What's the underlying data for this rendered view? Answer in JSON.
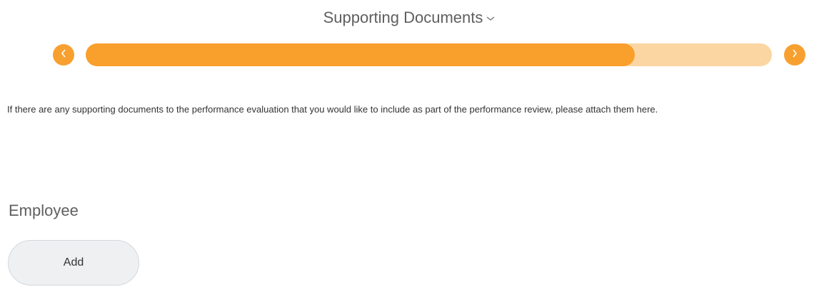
{
  "header": {
    "title": "Supporting Documents",
    "dropdown_icon": "chevron-down-icon"
  },
  "progress": {
    "fraction": 0.8,
    "prev_icon": "chevron-left-icon",
    "next_icon": "chevron-right-icon",
    "accent_color": "#f99f2b",
    "track_color": "#fbd6a2"
  },
  "instructions": {
    "text": "If there are any supporting documents to the performance evaluation that you would like to include as part of the performance review, please attach them here."
  },
  "employee_section": {
    "title": "Employee",
    "add_label": "Add"
  }
}
